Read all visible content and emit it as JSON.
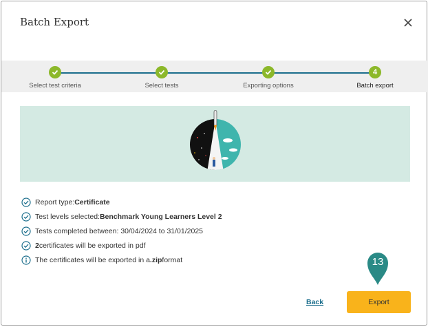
{
  "dialog": {
    "title": "Batch Export"
  },
  "stepper": {
    "steps": [
      {
        "label": "Select test criteria",
        "state": "done"
      },
      {
        "label": "Select tests",
        "state": "done"
      },
      {
        "label": "Exporting options",
        "state": "done"
      },
      {
        "label": "Batch export",
        "state": "active",
        "number": "4"
      }
    ]
  },
  "summary": {
    "report_type_label": "Report type: ",
    "report_type_value": "Certificate",
    "levels_label": "Test levels selected: ",
    "levels_value": "Benchmark Young Learners Level 2",
    "completed_text": "Tests completed between: 30/04/2024 to 31/01/2025",
    "count_value": "2",
    "count_text": " certificates will be exported in pdf",
    "format_text_pre": "The certificates will be exported in a ",
    "format_value": ".zip",
    "format_text_post": " format"
  },
  "marker": {
    "number": "13"
  },
  "actions": {
    "back_label": "Back",
    "export_label": "Export"
  },
  "colors": {
    "accent": "#1b6e8c",
    "step_done": "#8cb82a",
    "export_button": "#f9b31b",
    "banner": "#d4eae3",
    "marker": "#2a8a86"
  }
}
